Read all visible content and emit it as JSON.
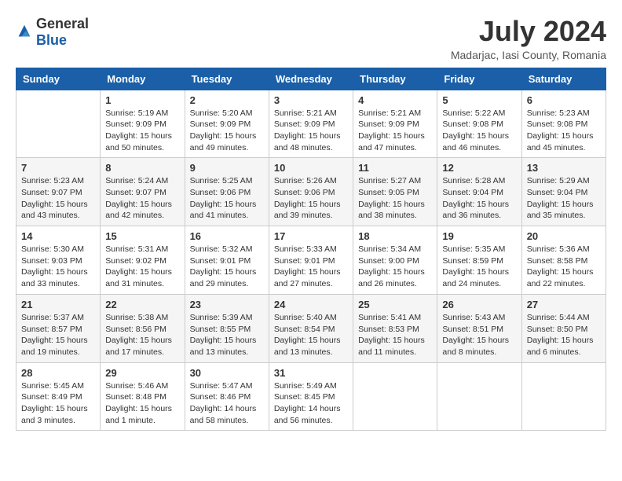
{
  "header": {
    "logo": {
      "general": "General",
      "blue": "Blue"
    },
    "title": "July 2024",
    "location": "Madarjac, Iasi County, Romania"
  },
  "calendar": {
    "weekdays": [
      "Sunday",
      "Monday",
      "Tuesday",
      "Wednesday",
      "Thursday",
      "Friday",
      "Saturday"
    ],
    "weeks": [
      [
        {
          "day": null,
          "sunrise": null,
          "sunset": null,
          "daylight": null
        },
        {
          "day": "1",
          "sunrise": "Sunrise: 5:19 AM",
          "sunset": "Sunset: 9:09 PM",
          "daylight": "Daylight: 15 hours and 50 minutes."
        },
        {
          "day": "2",
          "sunrise": "Sunrise: 5:20 AM",
          "sunset": "Sunset: 9:09 PM",
          "daylight": "Daylight: 15 hours and 49 minutes."
        },
        {
          "day": "3",
          "sunrise": "Sunrise: 5:21 AM",
          "sunset": "Sunset: 9:09 PM",
          "daylight": "Daylight: 15 hours and 48 minutes."
        },
        {
          "day": "4",
          "sunrise": "Sunrise: 5:21 AM",
          "sunset": "Sunset: 9:09 PM",
          "daylight": "Daylight: 15 hours and 47 minutes."
        },
        {
          "day": "5",
          "sunrise": "Sunrise: 5:22 AM",
          "sunset": "Sunset: 9:08 PM",
          "daylight": "Daylight: 15 hours and 46 minutes."
        },
        {
          "day": "6",
          "sunrise": "Sunrise: 5:23 AM",
          "sunset": "Sunset: 9:08 PM",
          "daylight": "Daylight: 15 hours and 45 minutes."
        }
      ],
      [
        {
          "day": "7",
          "sunrise": "Sunrise: 5:23 AM",
          "sunset": "Sunset: 9:07 PM",
          "daylight": "Daylight: 15 hours and 43 minutes."
        },
        {
          "day": "8",
          "sunrise": "Sunrise: 5:24 AM",
          "sunset": "Sunset: 9:07 PM",
          "daylight": "Daylight: 15 hours and 42 minutes."
        },
        {
          "day": "9",
          "sunrise": "Sunrise: 5:25 AM",
          "sunset": "Sunset: 9:06 PM",
          "daylight": "Daylight: 15 hours and 41 minutes."
        },
        {
          "day": "10",
          "sunrise": "Sunrise: 5:26 AM",
          "sunset": "Sunset: 9:06 PM",
          "daylight": "Daylight: 15 hours and 39 minutes."
        },
        {
          "day": "11",
          "sunrise": "Sunrise: 5:27 AM",
          "sunset": "Sunset: 9:05 PM",
          "daylight": "Daylight: 15 hours and 38 minutes."
        },
        {
          "day": "12",
          "sunrise": "Sunrise: 5:28 AM",
          "sunset": "Sunset: 9:04 PM",
          "daylight": "Daylight: 15 hours and 36 minutes."
        },
        {
          "day": "13",
          "sunrise": "Sunrise: 5:29 AM",
          "sunset": "Sunset: 9:04 PM",
          "daylight": "Daylight: 15 hours and 35 minutes."
        }
      ],
      [
        {
          "day": "14",
          "sunrise": "Sunrise: 5:30 AM",
          "sunset": "Sunset: 9:03 PM",
          "daylight": "Daylight: 15 hours and 33 minutes."
        },
        {
          "day": "15",
          "sunrise": "Sunrise: 5:31 AM",
          "sunset": "Sunset: 9:02 PM",
          "daylight": "Daylight: 15 hours and 31 minutes."
        },
        {
          "day": "16",
          "sunrise": "Sunrise: 5:32 AM",
          "sunset": "Sunset: 9:01 PM",
          "daylight": "Daylight: 15 hours and 29 minutes."
        },
        {
          "day": "17",
          "sunrise": "Sunrise: 5:33 AM",
          "sunset": "Sunset: 9:01 PM",
          "daylight": "Daylight: 15 hours and 27 minutes."
        },
        {
          "day": "18",
          "sunrise": "Sunrise: 5:34 AM",
          "sunset": "Sunset: 9:00 PM",
          "daylight": "Daylight: 15 hours and 26 minutes."
        },
        {
          "day": "19",
          "sunrise": "Sunrise: 5:35 AM",
          "sunset": "Sunset: 8:59 PM",
          "daylight": "Daylight: 15 hours and 24 minutes."
        },
        {
          "day": "20",
          "sunrise": "Sunrise: 5:36 AM",
          "sunset": "Sunset: 8:58 PM",
          "daylight": "Daylight: 15 hours and 22 minutes."
        }
      ],
      [
        {
          "day": "21",
          "sunrise": "Sunrise: 5:37 AM",
          "sunset": "Sunset: 8:57 PM",
          "daylight": "Daylight: 15 hours and 19 minutes."
        },
        {
          "day": "22",
          "sunrise": "Sunrise: 5:38 AM",
          "sunset": "Sunset: 8:56 PM",
          "daylight": "Daylight: 15 hours and 17 minutes."
        },
        {
          "day": "23",
          "sunrise": "Sunrise: 5:39 AM",
          "sunset": "Sunset: 8:55 PM",
          "daylight": "Daylight: 15 hours and 13 minutes."
        },
        {
          "day": "24",
          "sunrise": "Sunrise: 5:40 AM",
          "sunset": "Sunset: 8:54 PM",
          "daylight": "Daylight: 15 hours and 13 minutes."
        },
        {
          "day": "25",
          "sunrise": "Sunrise: 5:41 AM",
          "sunset": "Sunset: 8:53 PM",
          "daylight": "Daylight: 15 hours and 11 minutes."
        },
        {
          "day": "26",
          "sunrise": "Sunrise: 5:43 AM",
          "sunset": "Sunset: 8:51 PM",
          "daylight": "Daylight: 15 hours and 8 minutes."
        },
        {
          "day": "27",
          "sunrise": "Sunrise: 5:44 AM",
          "sunset": "Sunset: 8:50 PM",
          "daylight": "Daylight: 15 hours and 6 minutes."
        }
      ],
      [
        {
          "day": "28",
          "sunrise": "Sunrise: 5:45 AM",
          "sunset": "Sunset: 8:49 PM",
          "daylight": "Daylight: 15 hours and 3 minutes."
        },
        {
          "day": "29",
          "sunrise": "Sunrise: 5:46 AM",
          "sunset": "Sunset: 8:48 PM",
          "daylight": "Daylight: 15 hours and 1 minute."
        },
        {
          "day": "30",
          "sunrise": "Sunrise: 5:47 AM",
          "sunset": "Sunset: 8:46 PM",
          "daylight": "Daylight: 14 hours and 58 minutes."
        },
        {
          "day": "31",
          "sunrise": "Sunrise: 5:49 AM",
          "sunset": "Sunset: 8:45 PM",
          "daylight": "Daylight: 14 hours and 56 minutes."
        },
        {
          "day": null,
          "sunrise": null,
          "sunset": null,
          "daylight": null
        },
        {
          "day": null,
          "sunrise": null,
          "sunset": null,
          "daylight": null
        },
        {
          "day": null,
          "sunrise": null,
          "sunset": null,
          "daylight": null
        }
      ]
    ]
  }
}
